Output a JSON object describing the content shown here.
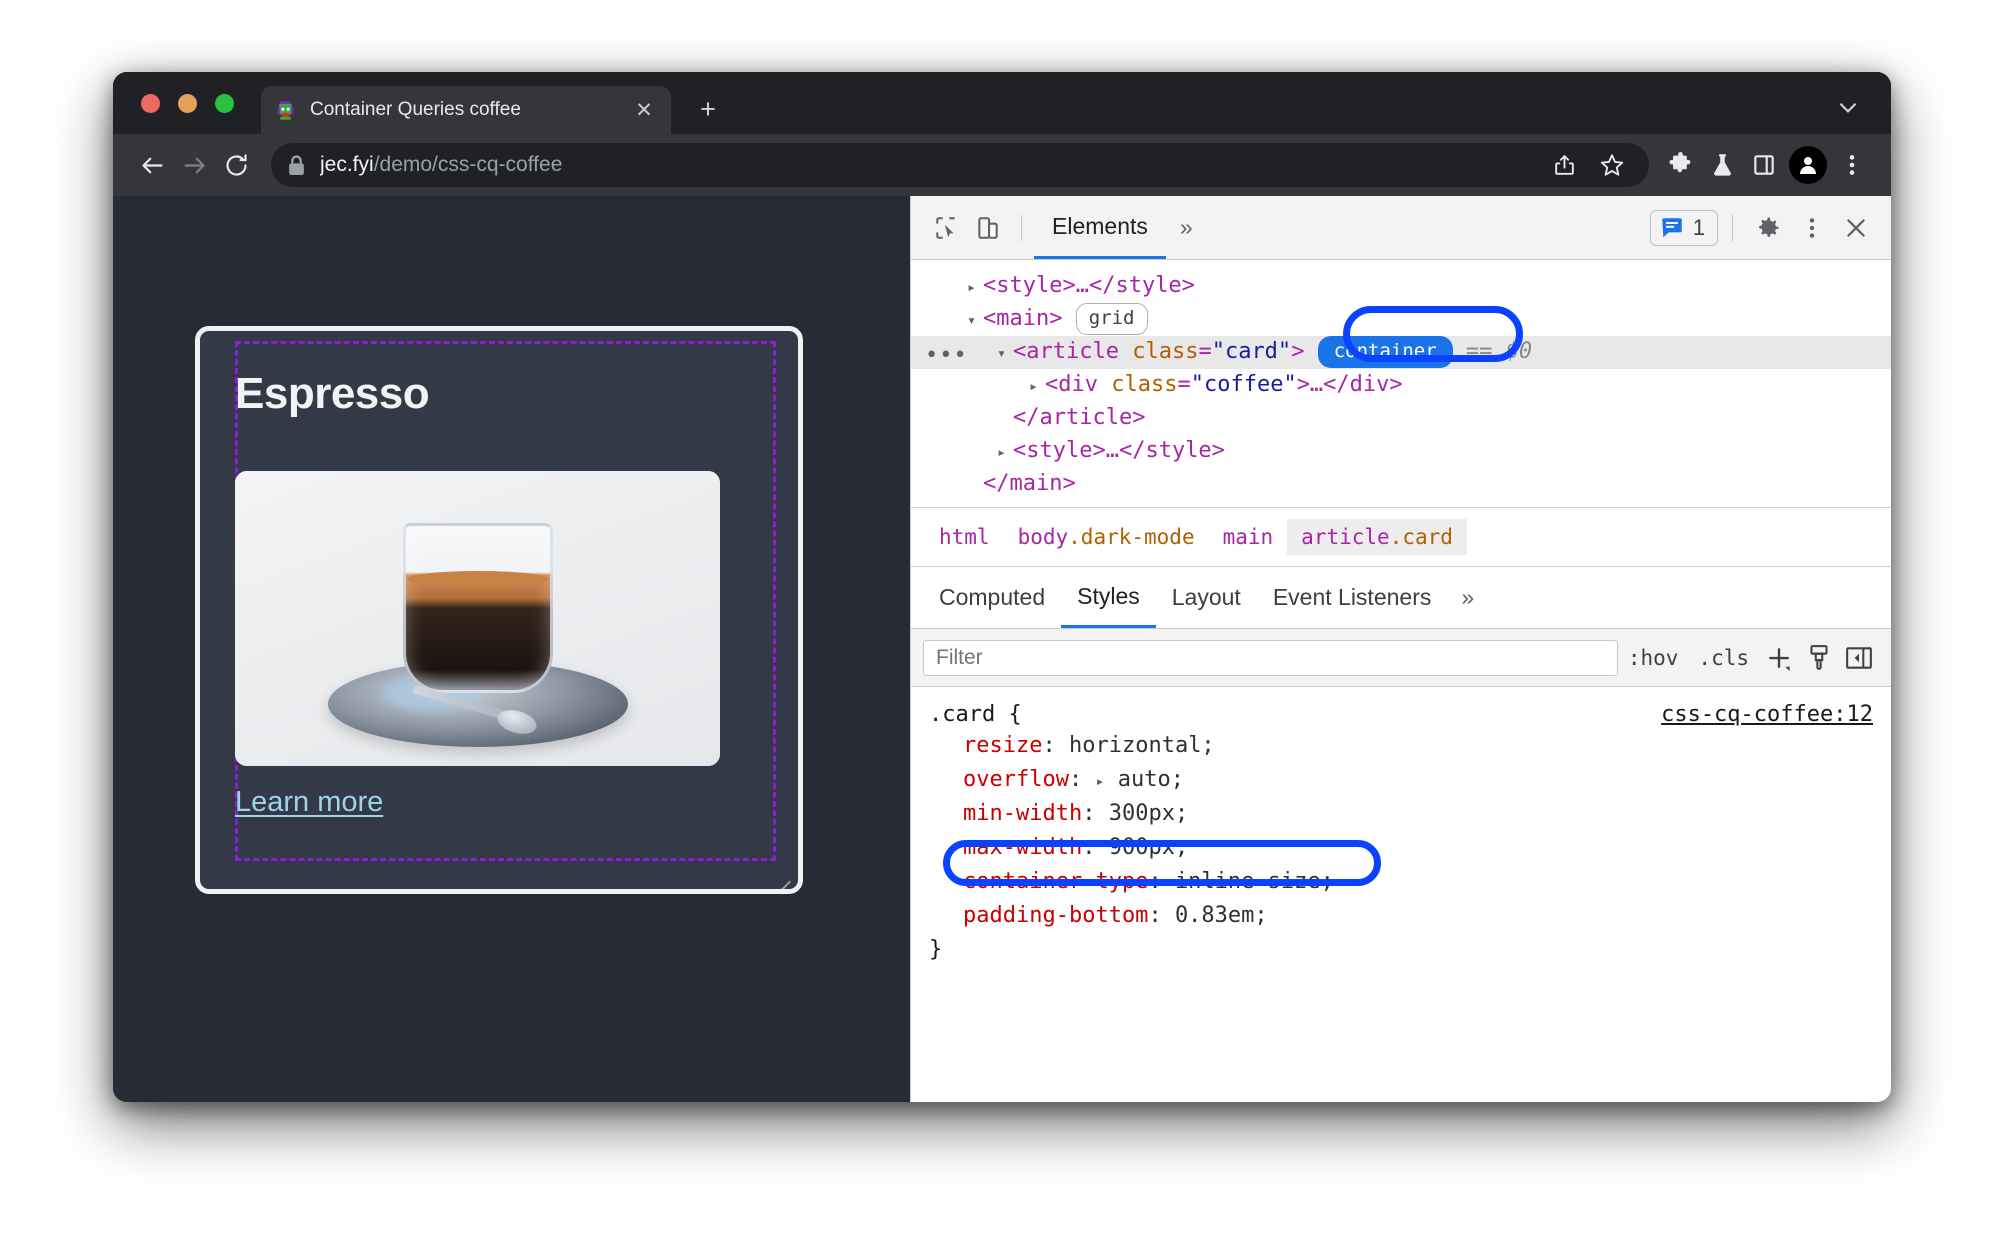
{
  "browser": {
    "traffic_lights": [
      "close",
      "minimize",
      "maximize"
    ],
    "tab": {
      "title": "Container Queries coffee",
      "favicon": "pixel-monster-favicon",
      "close_label": "✕"
    },
    "new_tab_label": "+",
    "tabstrip_chevron": "chevron-down-icon",
    "nav": {
      "back": "back-arrow-icon",
      "forward": "forward-arrow-icon",
      "reload": "reload-icon"
    },
    "omnibox": {
      "lock": "lock-icon",
      "host": "jec.fyi",
      "path": "/demo/css-cq-coffee",
      "full_url": "jec.fyi/demo/css-cq-coffee"
    },
    "toolbar_icons": [
      "share-icon",
      "bookmark-star-icon",
      "extensions-puzzle-icon",
      "labs-flask-icon",
      "side-panel-icon",
      "profile-avatar-icon",
      "three-dot-menu-icon"
    ]
  },
  "page": {
    "card": {
      "title": "Espresso",
      "link_label": "Learn more",
      "photo_alt": "espresso-glass-on-saucer-photo",
      "resize_handle": "resize-handle"
    }
  },
  "devtools": {
    "toolbar": {
      "inspect_icon": "inspect-element-icon",
      "device_icon": "device-toolbar-icon",
      "panels": [
        "Elements"
      ],
      "more_panels": "»",
      "issues_icon": "issues-message-icon",
      "issues_count": "1",
      "settings_icon": "gear-icon",
      "kebab_icon": "three-dot-menu-icon",
      "close_icon": "close-icon"
    },
    "dom": {
      "rows": [
        {
          "id": "style-open",
          "indent": 2,
          "triangle": "▸",
          "html": "<style>…</style>"
        },
        {
          "id": "main-open",
          "indent": 2,
          "triangle": "▾",
          "html": "<main>",
          "badge": "grid"
        },
        {
          "id": "article-card",
          "indent": 3,
          "triangle": "▾",
          "tag": "<article",
          "attr_name": "class",
          "attr_value": "\"card\"",
          "tag_end": ">",
          "badge": "container",
          "suffix": "== $0",
          "selected": true,
          "ellipsis": "•••"
        },
        {
          "id": "div-coffee",
          "indent": 4,
          "triangle": "▸",
          "tag": "<div",
          "attr_name": "class",
          "attr_value": "\"coffee\"",
          "tag_end": ">…</div>"
        },
        {
          "id": "article-close",
          "indent": 3,
          "triangle": "",
          "html": "</article>"
        },
        {
          "id": "style-2",
          "indent": 2,
          "triangle": "▸",
          "html": "<style>…</style>"
        },
        {
          "id": "main-close",
          "indent": 2,
          "triangle": "",
          "html": "</main>"
        }
      ]
    },
    "breadcrumb": [
      {
        "tag": "html",
        "cls": "",
        "active": false
      },
      {
        "tag": "body",
        "cls": ".dark-mode",
        "active": false
      },
      {
        "tag": "main",
        "cls": "",
        "active": false
      },
      {
        "tag": "article",
        "cls": ".card",
        "active": true
      }
    ],
    "styles_tabs": [
      {
        "label": "Computed",
        "active": false
      },
      {
        "label": "Styles",
        "active": true
      },
      {
        "label": "Layout",
        "active": false
      },
      {
        "label": "Event Listeners",
        "active": false
      }
    ],
    "styles_tabs_more": "»",
    "filter": {
      "placeholder": "Filter",
      "value": "",
      "hov_label": ":hov",
      "cls_label": ".cls",
      "new_rule_icon": "plus-icon",
      "styles_icon": "print-styles-icon",
      "sidebar_icon": "toggle-sidebar-icon"
    },
    "rule": {
      "selector": ".card {",
      "source": "css-cq-coffee:12",
      "close": "}",
      "declarations": [
        {
          "prop": "resize",
          "value": "horizontal;",
          "expandable": false,
          "highlighted": false
        },
        {
          "prop": "overflow",
          "value": "auto;",
          "expandable": true,
          "highlighted": false
        },
        {
          "prop": "min-width",
          "value": "300px;",
          "expandable": false,
          "highlighted": false
        },
        {
          "prop": "max-width",
          "value": "900px;",
          "expandable": false,
          "highlighted": false
        },
        {
          "prop": "container-type",
          "value": "inline-size;",
          "expandable": false,
          "highlighted": true
        },
        {
          "prop": "padding-bottom",
          "value": "0.83em;",
          "expandable": false,
          "highlighted": false
        }
      ]
    }
  },
  "annotations": {
    "ring_color": "#0a43ff",
    "targets": [
      "container-badge",
      "container-type-declaration"
    ]
  },
  "colors": {
    "chrome_frame": "#202124",
    "chrome_toolbar": "#35363a",
    "page_bg": "#272b36",
    "card_bg": "#333946",
    "card_border": "#f1f1f1",
    "container_outline": "#8c1ed6",
    "link": "#9fd3e8",
    "devtools_accent": "#1a73e8",
    "css_prop": "#c80000",
    "dom_tag": "#a626a4",
    "dom_attr": "#b06000",
    "dom_value": "#1a1aa6"
  }
}
